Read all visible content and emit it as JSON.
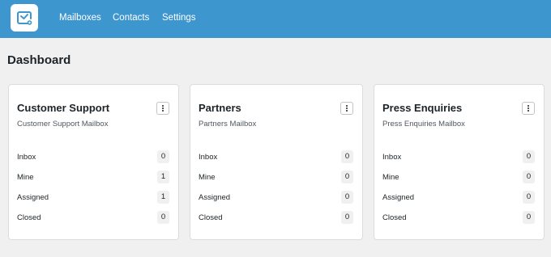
{
  "nav": {
    "logo_icon": "mailbox-check-icon",
    "items": [
      {
        "label": "Mailboxes"
      },
      {
        "label": "Contacts"
      },
      {
        "label": "Settings"
      }
    ]
  },
  "page": {
    "title": "Dashboard"
  },
  "colors": {
    "accent": "#3e96cf",
    "background": "#f0f0f1"
  },
  "mailboxes": [
    {
      "title": "Customer Support",
      "subtitle": "Customer Support Mailbox",
      "menu_icon": "more-vertical-icon",
      "stats": [
        {
          "label": "Inbox",
          "count": "0"
        },
        {
          "label": "Mine",
          "count": "1"
        },
        {
          "label": "Assigned",
          "count": "1"
        },
        {
          "label": "Closed",
          "count": "0"
        }
      ]
    },
    {
      "title": "Partners",
      "subtitle": "Partners Mailbox",
      "menu_icon": "more-vertical-icon",
      "stats": [
        {
          "label": "Inbox",
          "count": "0"
        },
        {
          "label": "Mine",
          "count": "0"
        },
        {
          "label": "Assigned",
          "count": "0"
        },
        {
          "label": "Closed",
          "count": "0"
        }
      ]
    },
    {
      "title": "Press Enquiries",
      "subtitle": "Press Enquiries Mailbox",
      "menu_icon": "more-vertical-icon",
      "stats": [
        {
          "label": "Inbox",
          "count": "0"
        },
        {
          "label": "Mine",
          "count": "0"
        },
        {
          "label": "Assigned",
          "count": "0"
        },
        {
          "label": "Closed",
          "count": "0"
        }
      ]
    }
  ]
}
